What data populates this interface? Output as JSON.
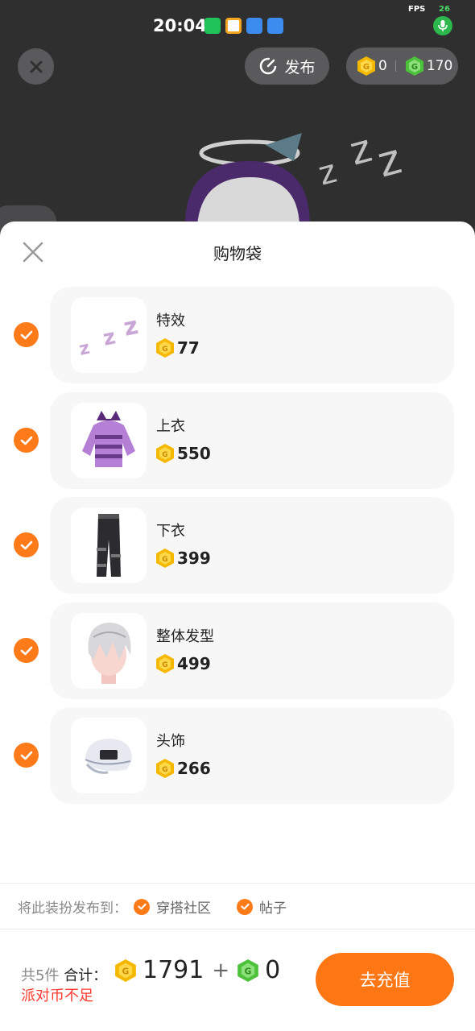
{
  "statusbar": {
    "time": "20:04",
    "fps_label": "FPS",
    "fps_value": "26",
    "app_icons": [
      "iqiyi-icon",
      "browser-icon",
      "planet-icon",
      "planet-icon"
    ]
  },
  "topbar": {
    "publish_label": "发布",
    "coin_gold": "0",
    "coin_green": "170"
  },
  "sheet": {
    "title": "购物袋",
    "items": [
      {
        "name": "特效",
        "price": "77",
        "checked": true,
        "icon": "zzz-effect-icon"
      },
      {
        "name": "上衣",
        "price": "550",
        "checked": true,
        "icon": "hoodie-icon"
      },
      {
        "name": "下衣",
        "price": "399",
        "checked": true,
        "icon": "pants-icon"
      },
      {
        "name": "整体发型",
        "price": "499",
        "checked": true,
        "icon": "hair-icon"
      },
      {
        "name": "头饰",
        "price": "266",
        "checked": true,
        "icon": "cap-icon"
      }
    ],
    "publish_to": {
      "label": "将此装扮发布到：",
      "options": [
        "穿搭社区",
        "帖子"
      ]
    },
    "footer": {
      "count": "共5件",
      "total_label": "合计：",
      "gold_total": "1791",
      "plus": "+",
      "green_total": "0",
      "warning": "派对币不足",
      "recharge_label": "去充值"
    }
  },
  "colors": {
    "accent": "#ff7614",
    "warning": "#ff3b30",
    "gold_coin": "#f5b800",
    "green_coin": "#4cc23a"
  }
}
